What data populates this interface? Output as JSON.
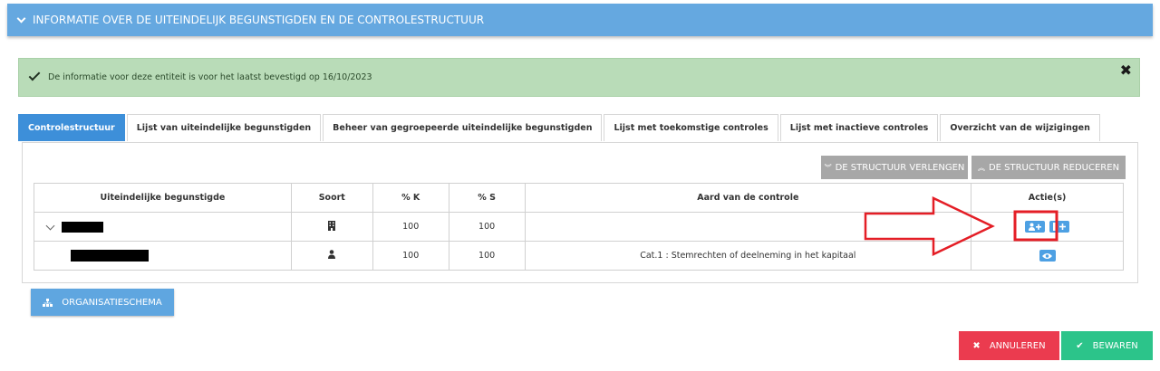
{
  "header": {
    "title": "INFORMATIE OVER DE UITEINDELIJK BEGUNSTIGDEN EN DE CONTROLESTRUCTUUR"
  },
  "alert": {
    "message": "De informatie voor deze entiteit is voor het laatst bevestigd op 16/10/2023",
    "close_label": "✖"
  },
  "tabs": [
    {
      "label": "Controlestructuur",
      "active": true
    },
    {
      "label": "Lijst van uiteindelijke begunstigden"
    },
    {
      "label": "Beheer van gegroepeerde uiteindelijke begunstigden"
    },
    {
      "label": "Lijst met toekomstige controles"
    },
    {
      "label": "Lijst met inactieve controles"
    },
    {
      "label": "Overzicht van de wijzigingen"
    }
  ],
  "toolbar": {
    "extend_label": "DE STRUCTUUR VERLENGEN",
    "reduce_label": "DE STRUCTUUR REDUCEREN"
  },
  "table": {
    "headers": [
      "Uiteindelijke begunstigde",
      "Soort",
      "% K",
      "% S",
      "Aard van de controle",
      "Actie(s)"
    ],
    "rows": [
      {
        "name": "[redacted]",
        "type_icon": "building-icon",
        "k": "100",
        "s": "100",
        "aard": "",
        "actions": [
          "add-person-icon",
          "add-entity-icon"
        ]
      },
      {
        "name": "[redacted]",
        "type_icon": "person-icon",
        "k": "100",
        "s": "100",
        "aard": "Cat.1 : Stemrechten of deelneming in het kapitaal",
        "actions": [
          "eye-icon"
        ]
      }
    ]
  },
  "buttons": {
    "org_label": "ORGANISATIESCHEMA",
    "cancel_label": "ANNULEREN",
    "save_label": "BEWAREN"
  },
  "colors": {
    "header": "#65a8e0",
    "alert_bg": "#b9dcb8",
    "tab_active": "#3d8fd9",
    "cancel": "#eb3b4f",
    "save": "#2cc48a",
    "annotation": "#e41e26"
  }
}
